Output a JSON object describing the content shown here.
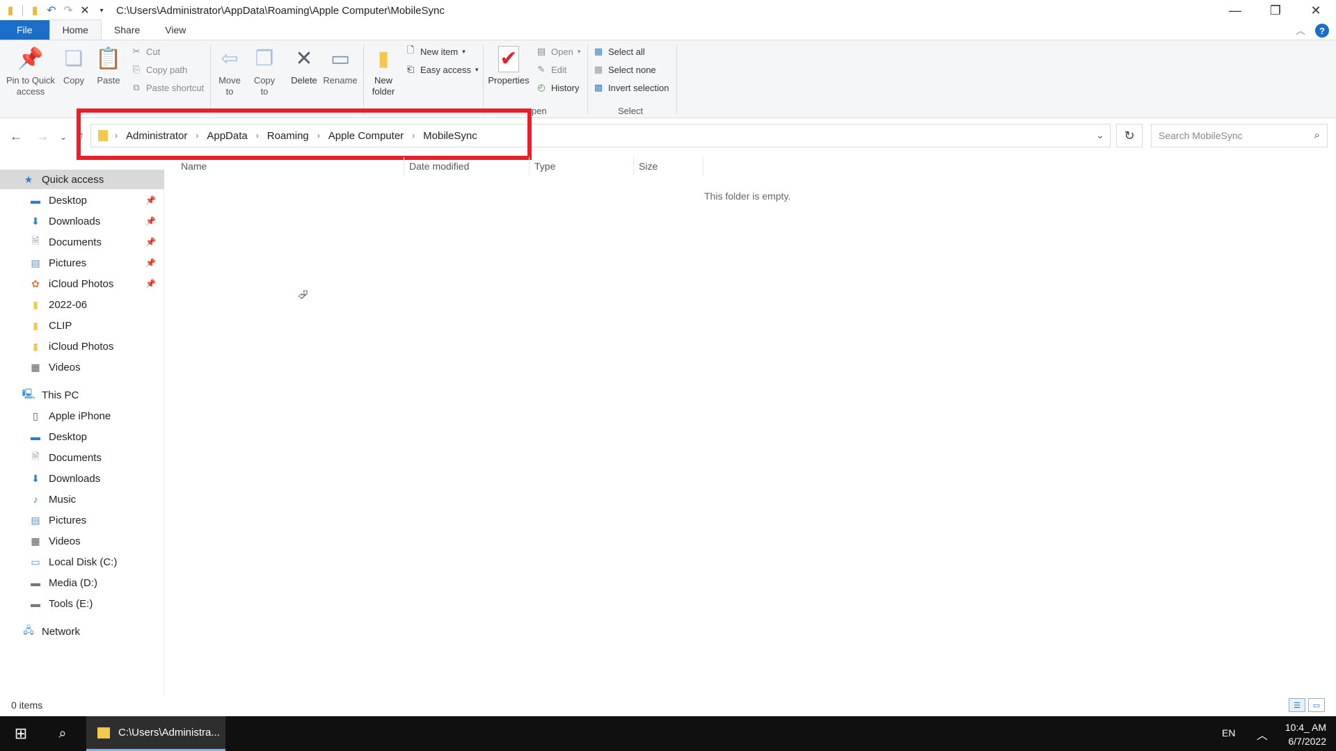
{
  "window": {
    "title_path": "C:\\Users\\Administrator\\AppData\\Roaming\\Apple Computer\\MobileSync",
    "controls": [
      "—",
      "❐",
      "✕"
    ]
  },
  "ribbon_tabs": [
    "File",
    "Home",
    "Share",
    "View"
  ],
  "ribbon": {
    "pin_label": "Pin to Quick\naccess",
    "copy_label": "Copy",
    "paste_label": "Paste",
    "cut_label": "Cut",
    "copy_path_label": "Copy path",
    "paste_shortcut_label": "Paste shortcut",
    "move_to_label": "Move\nto",
    "copy_to_label": "Copy\nto",
    "delete_label": "Delete",
    "rename_label": "Rename",
    "new_folder_label": "New\nfolder",
    "new_item_label": "New item",
    "easy_access_label": "Easy access",
    "properties_label": "Properties",
    "open_label": "Open",
    "edit_label": "Edit",
    "history_label": "History",
    "open_group_fragment": "pen",
    "select_all_label": "Select all",
    "select_none_label": "Select none",
    "invert_selection_label": "Invert selection",
    "select_group_label": "Select"
  },
  "address": {
    "breadcrumbs": [
      "Administrator",
      "AppData",
      "Roaming",
      "Apple Computer",
      "MobileSync"
    ],
    "search_placeholder": "Search MobileSync"
  },
  "nav": {
    "quick_access": "Quick access",
    "quick_items": [
      {
        "label": "Desktop",
        "icon": "desktop-icon",
        "pinned": true
      },
      {
        "label": "Downloads",
        "icon": "downloads-icon",
        "pinned": true
      },
      {
        "label": "Documents",
        "icon": "documents-icon",
        "pinned": true
      },
      {
        "label": "Pictures",
        "icon": "pictures-icon",
        "pinned": true
      },
      {
        "label": "iCloud Photos",
        "icon": "icloud-photos-icon",
        "pinned": true
      },
      {
        "label": "2022-06",
        "icon": "folder-icon",
        "pinned": false
      },
      {
        "label": "CLIP",
        "icon": "folder-icon",
        "pinned": false
      },
      {
        "label": "iCloud Photos",
        "icon": "folder-icon",
        "pinned": false
      },
      {
        "label": "Videos",
        "icon": "videos-icon",
        "pinned": false
      }
    ],
    "this_pc": "This PC",
    "pc_items": [
      {
        "label": "Apple iPhone",
        "icon": "phone-icon"
      },
      {
        "label": "Desktop",
        "icon": "desktop-icon"
      },
      {
        "label": "Documents",
        "icon": "documents-icon"
      },
      {
        "label": "Downloads",
        "icon": "downloads-icon"
      },
      {
        "label": "Music",
        "icon": "music-icon"
      },
      {
        "label": "Pictures",
        "icon": "pictures-icon"
      },
      {
        "label": "Videos",
        "icon": "videos-icon"
      },
      {
        "label": "Local Disk (C:)",
        "icon": "disk-icon"
      },
      {
        "label": "Media (D:)",
        "icon": "drive-icon"
      },
      {
        "label": "Tools (E:)",
        "icon": "drive-icon"
      }
    ],
    "network": "Network"
  },
  "columns": [
    "Name",
    "Date modified",
    "Type",
    "Size"
  ],
  "empty_message": "This folder is empty.",
  "status": {
    "items_count": "0 items"
  },
  "taskbar": {
    "app_label": "C:\\Users\\Administra...",
    "language": "EN",
    "time": "10:4_ AM",
    "date": "6/7/2022"
  }
}
